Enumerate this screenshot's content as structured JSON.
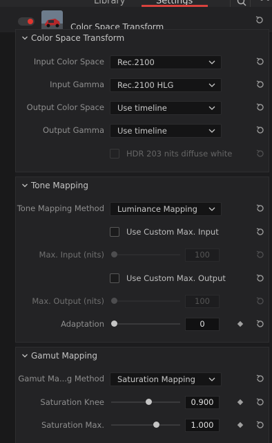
{
  "tabs": {
    "library": "Library",
    "settings": "Settings"
  },
  "fx": {
    "title": "Color Space Transform"
  },
  "sections": {
    "cst": {
      "title": "Color Space Transform",
      "input_color_space": {
        "label": "Input Color Space",
        "value": "Rec.2100"
      },
      "input_gamma": {
        "label": "Input Gamma",
        "value": "Rec.2100 HLG"
      },
      "output_color_space": {
        "label": "Output Color Space",
        "value": "Use timeline"
      },
      "output_gamma": {
        "label": "Output Gamma",
        "value": "Use timeline"
      },
      "hdr203": {
        "label": "HDR 203 nits diffuse white",
        "checked": false
      }
    },
    "tone": {
      "title": "Tone Mapping",
      "method": {
        "label": "Tone Mapping Method",
        "value": "Luminance Mapping"
      },
      "custom_max_input": {
        "label": "Use Custom Max. Input",
        "checked": false
      },
      "max_input": {
        "label": "Max. Input (nits)",
        "value": "100"
      },
      "custom_max_output": {
        "label": "Use Custom Max. Output",
        "checked": false
      },
      "max_output": {
        "label": "Max. Output (nits)",
        "value": "100"
      },
      "adaptation": {
        "label": "Adaptation",
        "value": "0",
        "fraction": 0.0
      }
    },
    "gamut": {
      "title": "Gamut Mapping",
      "method": {
        "label": "Gamut Ma...g Method",
        "value": "Saturation Mapping"
      },
      "saturation_knee": {
        "label": "Saturation Knee",
        "value": "0.900",
        "fraction": 0.55
      },
      "saturation_max": {
        "label": "Saturation Max.",
        "value": "1.000",
        "fraction": 0.67
      }
    }
  },
  "colors": {
    "accent_red": "#d8423d",
    "toggle_on": "#e0362f"
  },
  "icons": [
    "search-icon",
    "more-icon",
    "reset-icon",
    "chevron-down-icon",
    "keyframe-icon"
  ]
}
